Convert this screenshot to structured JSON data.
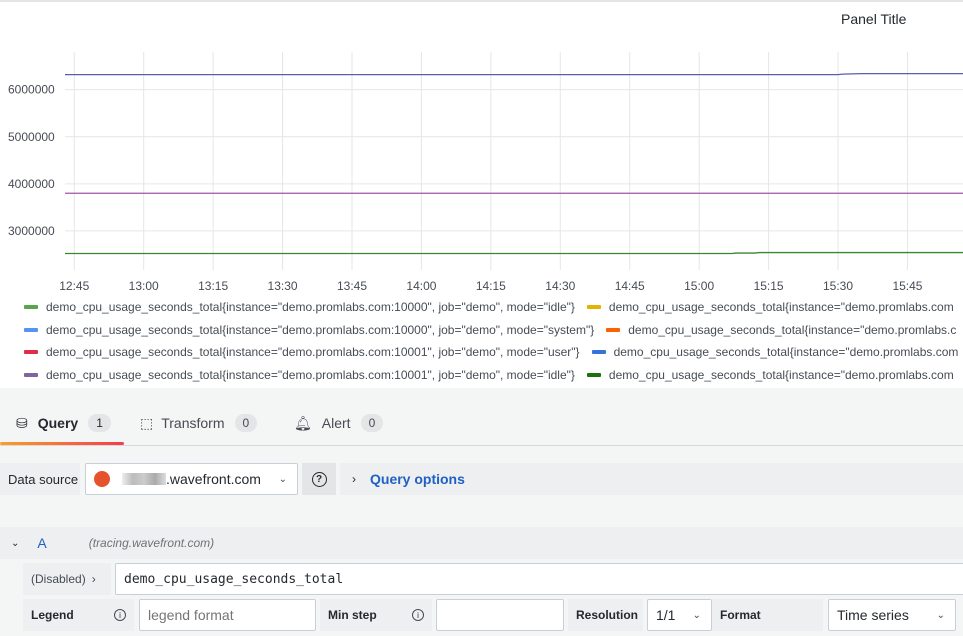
{
  "panel": {
    "title": "Panel Title"
  },
  "chart_data": {
    "type": "line",
    "yticks": [
      "6000000",
      "5000000",
      "4000000",
      "3000000"
    ],
    "xticks": [
      "12:45",
      "13:00",
      "13:15",
      "13:30",
      "13:45",
      "14:00",
      "14:15",
      "14:30",
      "14:45",
      "15:00",
      "15:15",
      "15:30",
      "15:45"
    ],
    "xlim": [
      "12:43",
      "15:57"
    ],
    "ylim": [
      2170000,
      6800000
    ],
    "grid": true,
    "legend": "bottom",
    "series": [
      {
        "color": "#5a5fa8",
        "x": [
          "12:43",
          "15:30",
          "15:31",
          "15:35",
          "15:57"
        ],
        "y": [
          6320000,
          6320000,
          6330000,
          6340000,
          6340000
        ]
      },
      {
        "color": "#a352a8",
        "x": [
          "12:43",
          "15:57"
        ],
        "y": [
          3800000,
          3800000
        ]
      },
      {
        "color": "#37872d",
        "x": [
          "12:43",
          "15:07",
          "15:08",
          "15:12",
          "15:13",
          "15:57"
        ],
        "y": [
          2520000,
          2520000,
          2530000,
          2530000,
          2540000,
          2540000
        ]
      }
    ]
  },
  "legend": [
    [
      {
        "label": "demo_cpu_usage_seconds_total{instance=\"demo.promlabs.com:10000\", job=\"demo\", mode=\"idle\"}",
        "color": "#56a64b"
      },
      {
        "label": "demo_cpu_usage_seconds_total{instance=\"demo.promlabs.com",
        "color": "#e0b400"
      }
    ],
    [
      {
        "label": "demo_cpu_usage_seconds_total{instance=\"demo.promlabs.com:10000\", job=\"demo\", mode=\"system\"}",
        "color": "#5794f2"
      },
      {
        "label": "demo_cpu_usage_seconds_total{instance=\"demo.promlabs.c",
        "color": "#fa6400"
      }
    ],
    [
      {
        "label": "demo_cpu_usage_seconds_total{instance=\"demo.promlabs.com:10001\", job=\"demo\", mode=\"user\"}",
        "color": "#e02f44"
      },
      {
        "label": "demo_cpu_usage_seconds_total{instance=\"demo.promlabs.com",
        "color": "#3274d9"
      }
    ],
    [
      {
        "label": "demo_cpu_usage_seconds_total{instance=\"demo.promlabs.com:10001\", job=\"demo\", mode=\"idle\"}",
        "color": "#8064a2"
      },
      {
        "label": "demo_cpu_usage_seconds_total{instance=\"demo.promlabs.com",
        "color": "#19730e"
      }
    ]
  ],
  "tabs": [
    {
      "label": "Query",
      "count": "1",
      "icon": "database-icon"
    },
    {
      "label": "Transform",
      "count": "0",
      "icon": "transform-icon"
    },
    {
      "label": "Alert",
      "count": "0",
      "icon": "bell-icon"
    }
  ],
  "datasource": {
    "label": "Data source",
    "value": ".wavefront.com",
    "help": "?",
    "query_options": "Query options"
  },
  "query": {
    "ref": "A",
    "source": "(tracing.wavefront.com)",
    "disabled": "(Disabled)",
    "expr": "demo_cpu_usage_seconds_total",
    "legend_label": "Legend",
    "legend_placeholder": "legend format",
    "minstep_label": "Min step",
    "resolution_label": "Resolution",
    "resolution": "1/1",
    "format_label": "Format",
    "format": "Time series"
  },
  "colors": {
    "accent": "#1f60c4",
    "tab_underline_start": "#f99f28",
    "tab_underline_end": "#f43c4e"
  }
}
